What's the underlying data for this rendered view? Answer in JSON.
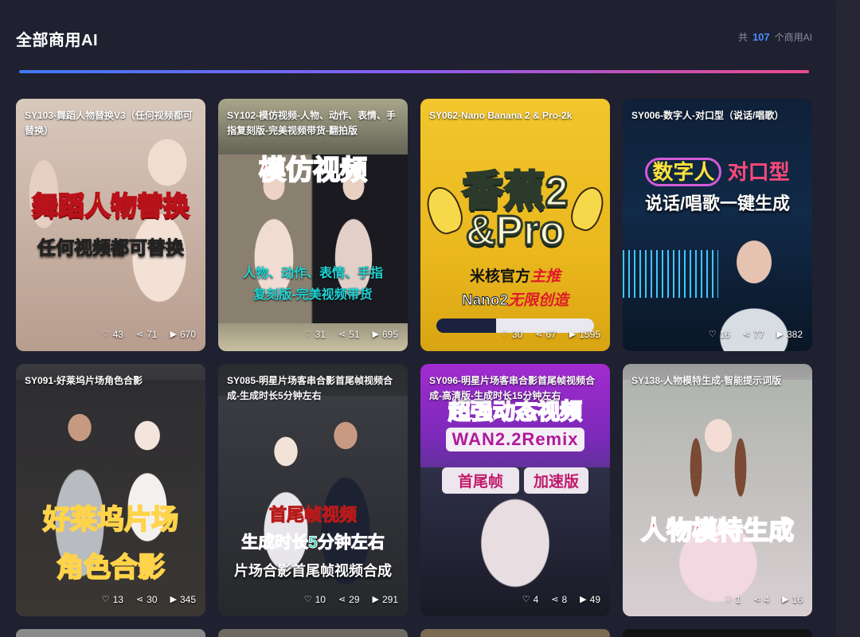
{
  "header": {
    "title": "全部商用AI",
    "count_prefix": "共",
    "count_value": "107",
    "count_suffix": "个商用AI"
  },
  "icons": {
    "like": "heart-icon",
    "share": "share-icon",
    "play": "play-icon"
  },
  "cards": [
    {
      "title": "SY103-舞蹈人物替换V3（任何视频都可替换）",
      "overlay_1": "舞蹈人物替换",
      "overlay_2": "任何视频都可替换",
      "likes": "43",
      "shares": "71",
      "plays": "670"
    },
    {
      "title": "SY102-模仿视频-人物、动作、表情、手指复刻版-完美视频带货-翻拍版",
      "overlay_1": "模仿视频",
      "overlay_2": "人物、动作、表情、手指",
      "overlay_3": "复刻版-完美视频带货",
      "likes": "31",
      "shares": "51",
      "plays": "695"
    },
    {
      "title": "SY062-Nano Banana 2 & Pro-2k",
      "overlay_1": "香蕉2",
      "overlay_2": "&Pro",
      "overlay_3": "米核官方",
      "overlay_3b": "主推",
      "overlay_4": "Nano2",
      "overlay_4b": "无限创造",
      "likes": "30",
      "shares": "67",
      "plays": "1595"
    },
    {
      "title": "SY006-数字人-对口型（说话/唱歌）",
      "overlay_1": "数字人",
      "overlay_1b": "对口型",
      "overlay_2": "说话/唱歌一键生成",
      "likes": "16",
      "shares": "77",
      "plays": "382"
    },
    {
      "title": "SY091-好莱坞片场角色合影",
      "overlay_1": "好莱坞片场",
      "overlay_2": "角色合影",
      "likes": "13",
      "shares": "30",
      "plays": "345"
    },
    {
      "title": "SY085-明星片场客串合影首尾帧视频合成-生成时长5分钟左右",
      "overlay_1": "首尾帧视频",
      "overlay_2": "生成时长5分钟左右",
      "overlay_3": "片场合影首尾帧视频合成",
      "likes": "10",
      "shares": "29",
      "plays": "291"
    },
    {
      "title": "SY096-明星片场客串合影首尾帧视频合成-高清版-生成时长15分钟左右",
      "overlay_1": "超强动态视频",
      "overlay_2": "WAN2.2Remix",
      "overlay_3": "首尾帧",
      "overlay_3b": "加速版",
      "likes": "4",
      "shares": "8",
      "plays": "49"
    },
    {
      "title": "SY138-人物模特生成-智能提示词版",
      "overlay_1": "人物模特生成",
      "likes": "1",
      "shares": "4",
      "plays": "16"
    }
  ]
}
